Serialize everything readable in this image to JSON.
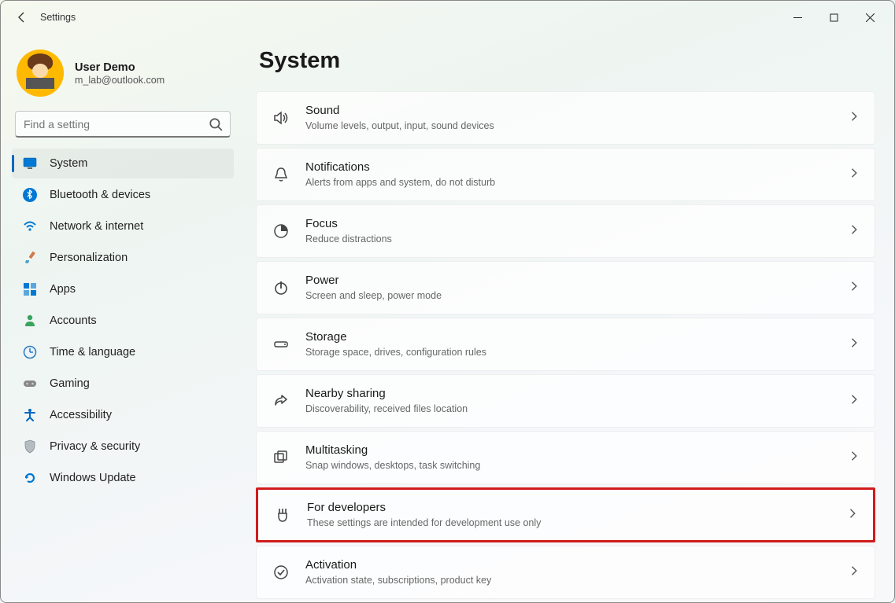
{
  "titlebar": {
    "app_name": "Settings"
  },
  "user": {
    "name": "User Demo",
    "email": "m_lab@outlook.com"
  },
  "search": {
    "placeholder": "Find a setting"
  },
  "nav": {
    "items": [
      {
        "id": "system",
        "label": "System",
        "selected": true,
        "icon": "monitor"
      },
      {
        "id": "bluetooth",
        "label": "Bluetooth & devices",
        "selected": false,
        "icon": "bluetooth"
      },
      {
        "id": "network",
        "label": "Network & internet",
        "selected": false,
        "icon": "wifi"
      },
      {
        "id": "personalization",
        "label": "Personalization",
        "selected": false,
        "icon": "brush"
      },
      {
        "id": "apps",
        "label": "Apps",
        "selected": false,
        "icon": "apps"
      },
      {
        "id": "accounts",
        "label": "Accounts",
        "selected": false,
        "icon": "person"
      },
      {
        "id": "time",
        "label": "Time & language",
        "selected": false,
        "icon": "clock"
      },
      {
        "id": "gaming",
        "label": "Gaming",
        "selected": false,
        "icon": "gamepad"
      },
      {
        "id": "accessibility",
        "label": "Accessibility",
        "selected": false,
        "icon": "accessibility"
      },
      {
        "id": "privacy",
        "label": "Privacy & security",
        "selected": false,
        "icon": "shield"
      },
      {
        "id": "update",
        "label": "Windows Update",
        "selected": false,
        "icon": "refresh"
      }
    ]
  },
  "main": {
    "heading": "System",
    "items": [
      {
        "id": "sound",
        "title": "Sound",
        "desc": "Volume levels, output, input, sound devices",
        "icon": "sound",
        "highlight": false
      },
      {
        "id": "notifications",
        "title": "Notifications",
        "desc": "Alerts from apps and system, do not disturb",
        "icon": "bell",
        "highlight": false
      },
      {
        "id": "focus",
        "title": "Focus",
        "desc": "Reduce distractions",
        "icon": "focus",
        "highlight": false
      },
      {
        "id": "power",
        "title": "Power",
        "desc": "Screen and sleep, power mode",
        "icon": "power",
        "highlight": false
      },
      {
        "id": "storage",
        "title": "Storage",
        "desc": "Storage space, drives, configuration rules",
        "icon": "drive",
        "highlight": false
      },
      {
        "id": "nearby",
        "title": "Nearby sharing",
        "desc": "Discoverability, received files location",
        "icon": "share",
        "highlight": false
      },
      {
        "id": "multitasking",
        "title": "Multitasking",
        "desc": "Snap windows, desktops, task switching",
        "icon": "multitask",
        "highlight": false
      },
      {
        "id": "developers",
        "title": "For developers",
        "desc": "These settings are intended for development use only",
        "icon": "wrench",
        "highlight": true
      },
      {
        "id": "activation",
        "title": "Activation",
        "desc": "Activation state, subscriptions, product key",
        "icon": "check-circle",
        "highlight": false
      }
    ]
  }
}
